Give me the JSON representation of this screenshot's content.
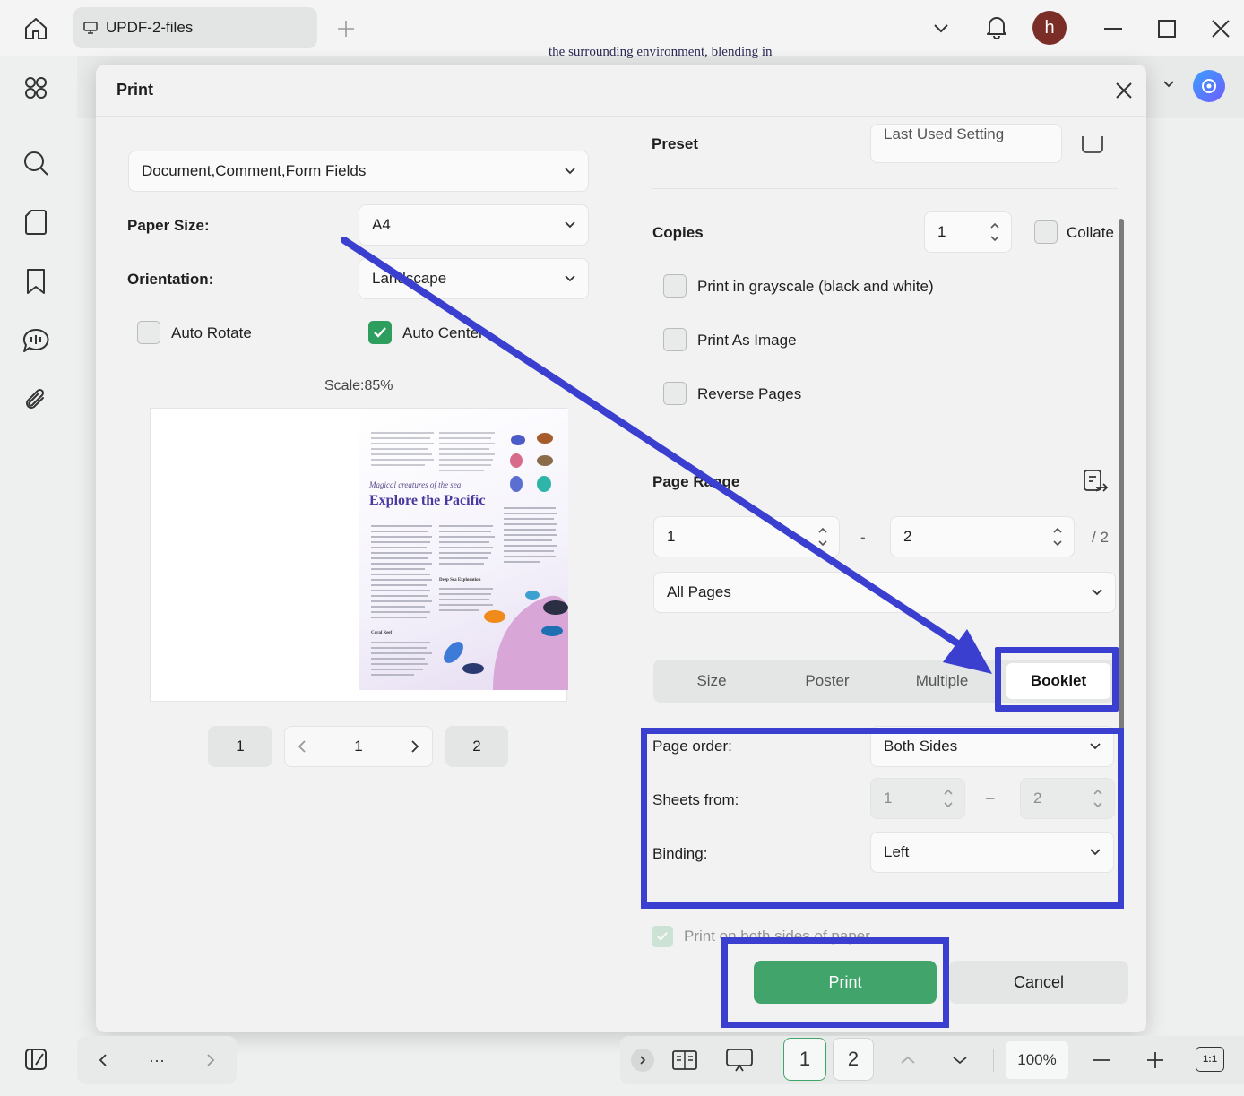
{
  "window": {
    "tab_label": "UPDF-2-files",
    "avatar_initial": "h"
  },
  "document": {
    "background_text": "the surrounding environment, blending in"
  },
  "dialog": {
    "title": "Print",
    "left": {
      "content_select": "Document,Comment,Form Fields",
      "paper_size_label": "Paper Size:",
      "paper_size_value": "A4",
      "orientation_label": "Orientation:",
      "orientation_value": "Landscape",
      "auto_rotate_label": "Auto Rotate",
      "auto_rotate_checked": false,
      "auto_center_label": "Auto Center",
      "auto_center_checked": true,
      "scale_text": "Scale:85%",
      "preview": {
        "subtitle": "Magical creatures of the sea",
        "title": "Explore the Pacific",
        "section_coral": "Coral Reef",
        "section_deep": "Deep Sea Exploration"
      },
      "pager": {
        "first": "1",
        "current": "1",
        "last": "2"
      }
    },
    "right": {
      "preset_label": "Preset",
      "preset_value": "Last Used Setting",
      "copies_label": "Copies",
      "copies_value": "1",
      "collate_label": "Collate",
      "grayscale_label": "Print in grayscale (black and white)",
      "print_as_image_label": "Print As Image",
      "reverse_pages_label": "Reverse Pages",
      "page_range_label": "Page Range",
      "range_from": "1",
      "range_dash": "-",
      "range_to": "2",
      "range_total": "/ 2",
      "pages_select": "All Pages",
      "modes": [
        "Size",
        "Poster",
        "Multiple",
        "Booklet"
      ],
      "active_mode": "Booklet",
      "page_order_label": "Page order:",
      "page_order_value": "Both Sides",
      "sheets_from_label": "Sheets from:",
      "sheets_from": "1",
      "sheets_dash": "–",
      "sheets_to": "2",
      "binding_label": "Binding:",
      "binding_value": "Left",
      "both_sides_label": "Print on both sides of paper",
      "both_sides_checked": true
    },
    "buttons": {
      "print": "Print",
      "cancel": "Cancel"
    }
  },
  "bottom_toolbar": {
    "more": "···",
    "page_1": "1",
    "page_2": "2",
    "zoom": "100%",
    "fit": "1:1"
  },
  "colors": {
    "accent_green": "#41a56b",
    "annotation_blue": "#3b3fd0",
    "avatar_bg": "#7b2e28"
  }
}
